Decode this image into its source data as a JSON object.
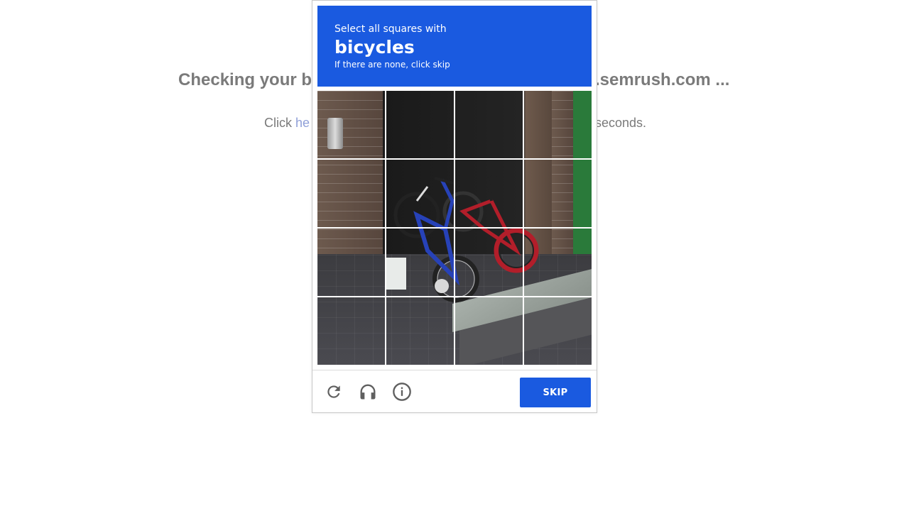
{
  "background": {
    "title_left": "Checking your b",
    "title_right": ".semrush.com ...",
    "sub_click": "Click ",
    "sub_link": "he",
    "sub_right": "seconds."
  },
  "challenge": {
    "instruction_line1": "Select all squares with",
    "target": "bicycles",
    "instruction_line3": "If there are none, click skip",
    "header_color": "#1a5ae0",
    "grid": {
      "rows": 4,
      "cols": 4
    },
    "footer": {
      "reload_icon": "reload-icon",
      "audio_icon": "headphones-icon",
      "info_icon": "info-icon",
      "skip_label": "SKIP"
    }
  }
}
